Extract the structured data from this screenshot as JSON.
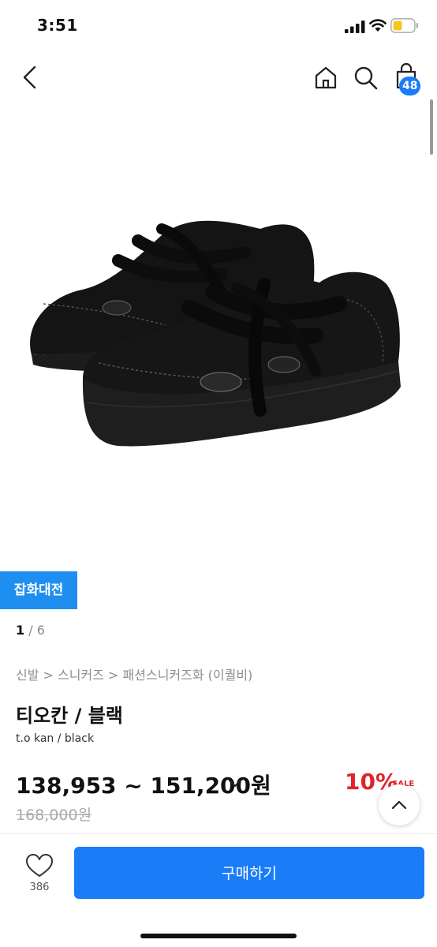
{
  "status_bar": {
    "time": "3:51"
  },
  "nav": {
    "back_icon": "chevron-left-icon",
    "home_icon": "home-icon",
    "search_icon": "search-icon",
    "cart_icon": "shopping-bag-icon",
    "cart_count": "48"
  },
  "product": {
    "image_alt": "black sneakers",
    "promo_tag": "잡화대전",
    "image_index": "1",
    "image_total": "6",
    "breadcrumb": [
      "신발",
      "스니커즈",
      "패션스니커즈화 (이퀄비)"
    ],
    "breadcrumb_separator": ">",
    "name": "티오칸 / 블랙",
    "subtitle": "t.o kan / black",
    "price_range": "138,953 ~ 151,200원",
    "original_price": "168,000원",
    "discount_percent": "10%",
    "discount_label": "SALE"
  },
  "actions": {
    "like_count": "386",
    "buy_label": "구매하기"
  },
  "colors": {
    "accent": "#1a7cf6",
    "promo": "#1e8ff0",
    "sale": "#e0242b"
  }
}
